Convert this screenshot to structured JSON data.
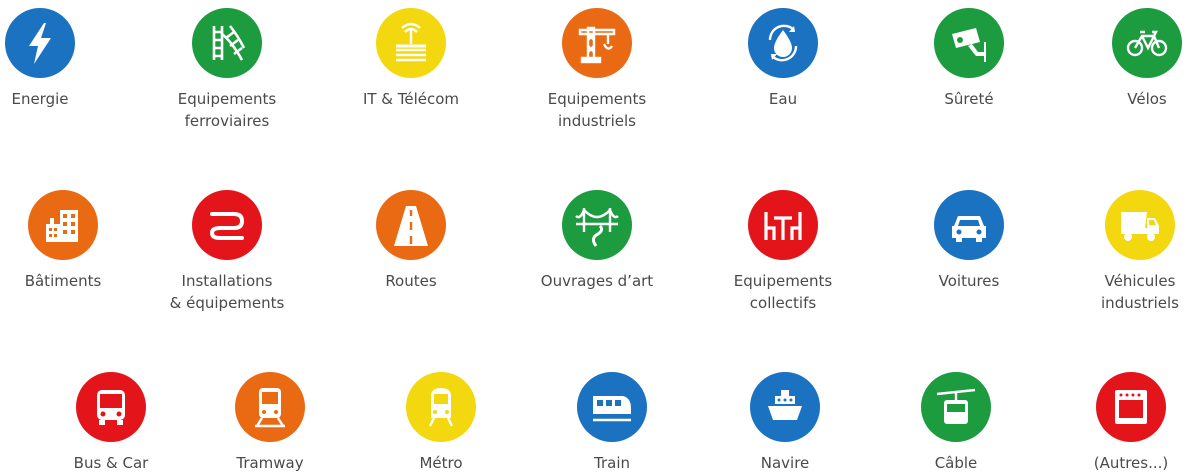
{
  "colors": {
    "blue": "#1b72c0",
    "green": "#1c9b3f",
    "yellow": "#f4d80f",
    "orange": "#ea6a14",
    "red": "#e3151b"
  },
  "categories": [
    {
      "label": "Energie",
      "icon": "lightning-icon",
      "color": "#1b72c0"
    },
    {
      "label": "Equipements\nferroviaires",
      "icon": "rail-switch-icon",
      "color": "#1c9b3f"
    },
    {
      "label": "IT & Télécom",
      "icon": "router-icon",
      "color": "#f4d80f"
    },
    {
      "label": "Equipements\nindustriels",
      "icon": "crane-icon",
      "color": "#ea6a14"
    },
    {
      "label": "Eau",
      "icon": "water-drop-icon",
      "color": "#1b72c0"
    },
    {
      "label": "Sûreté",
      "icon": "security-camera-icon",
      "color": "#1c9b3f"
    },
    {
      "label": "Vélos",
      "icon": "bicycle-icon",
      "color": "#1c9b3f"
    },
    {
      "label": "Bâtiments",
      "icon": "building-icon",
      "color": "#ea6a14"
    },
    {
      "label": "Installations\n& équipements",
      "icon": "pipes-icon",
      "color": "#e3151b"
    },
    {
      "label": "Routes",
      "icon": "road-icon",
      "color": "#ea6a14"
    },
    {
      "label": "Ouvrages d’art",
      "icon": "bridge-icon",
      "color": "#1c9b3f"
    },
    {
      "label": "Equipements\ncollectifs",
      "icon": "table-chairs-icon",
      "color": "#e3151b"
    },
    {
      "label": "Voitures",
      "icon": "car-icon",
      "color": "#1b72c0"
    },
    {
      "label": "Véhicules\nindustriels",
      "icon": "dump-truck-icon",
      "color": "#f4d80f"
    },
    {
      "label": "Bus & Car",
      "icon": "bus-icon",
      "color": "#e3151b"
    },
    {
      "label": "Tramway",
      "icon": "tram-icon",
      "color": "#ea6a14"
    },
    {
      "label": "Métro",
      "icon": "metro-icon",
      "color": "#f4d80f"
    },
    {
      "label": "Train",
      "icon": "train-icon",
      "color": "#1b72c0"
    },
    {
      "label": "Navire",
      "icon": "ship-icon",
      "color": "#1b72c0"
    },
    {
      "label": "Câble",
      "icon": "cable-car-icon",
      "color": "#1c9b3f"
    },
    {
      "label": "(Autres...)",
      "icon": "oven-icon",
      "color": "#e3151b"
    }
  ]
}
